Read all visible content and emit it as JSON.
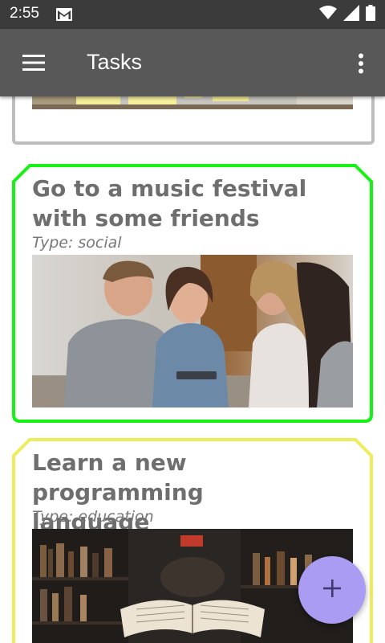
{
  "status_bar": {
    "time": "2:55"
  },
  "app_bar": {
    "title": "Tasks"
  },
  "tasks": [
    {
      "title_line1": "Go to a music festival",
      "title_line2": "with some friends",
      "type": "Type: social",
      "border_color": "#16f216"
    },
    {
      "title_line1": "Learn a new programming",
      "title_line2": "language",
      "type": "Type: education",
      "border_color": "#eded5b"
    }
  ],
  "colors": {
    "previous_card_border": "#bdbdbd",
    "app_bar": "#585858",
    "status_bar": "#3b3b3b",
    "fab": "#a99cf2"
  },
  "fab": {
    "icon": "plus-icon"
  }
}
